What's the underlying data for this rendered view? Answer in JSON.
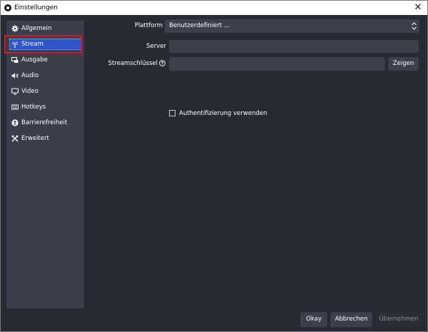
{
  "window": {
    "title": "Einstellungen",
    "close_glyph": "✕"
  },
  "sidebar": {
    "items": [
      {
        "label": "Allgemein",
        "icon": "gear-icon"
      },
      {
        "label": "Stream",
        "icon": "antenna-icon",
        "selected": true
      },
      {
        "label": "Ausgabe",
        "icon": "output-icon"
      },
      {
        "label": "Audio",
        "icon": "speaker-icon"
      },
      {
        "label": "Video",
        "icon": "monitor-icon"
      },
      {
        "label": "Hotkeys",
        "icon": "keyboard-icon"
      },
      {
        "label": "Barrierefreiheit",
        "icon": "accessibility-icon"
      },
      {
        "label": "Erweitert",
        "icon": "tools-icon"
      }
    ]
  },
  "stream": {
    "platform_label": "Plattform",
    "platform_value": "Benutzerdefiniert ...",
    "server_label": "Server",
    "server_value": "",
    "key_label": "Streamschlüssel",
    "key_value": "",
    "show_button": "Zeigen",
    "auth_checkbox_label": "Authentifizierung verwenden",
    "auth_checked": false
  },
  "footer": {
    "ok_button": "Okay",
    "cancel_button": "Abbrechen",
    "apply_button": "Übernehmen"
  },
  "colors": {
    "window_bg": "#272a33",
    "sidebar_bg": "#3a3e4b",
    "selection": "#2f55c8",
    "highlight_border": "#e0112b",
    "input_bg": "#3c404d"
  }
}
